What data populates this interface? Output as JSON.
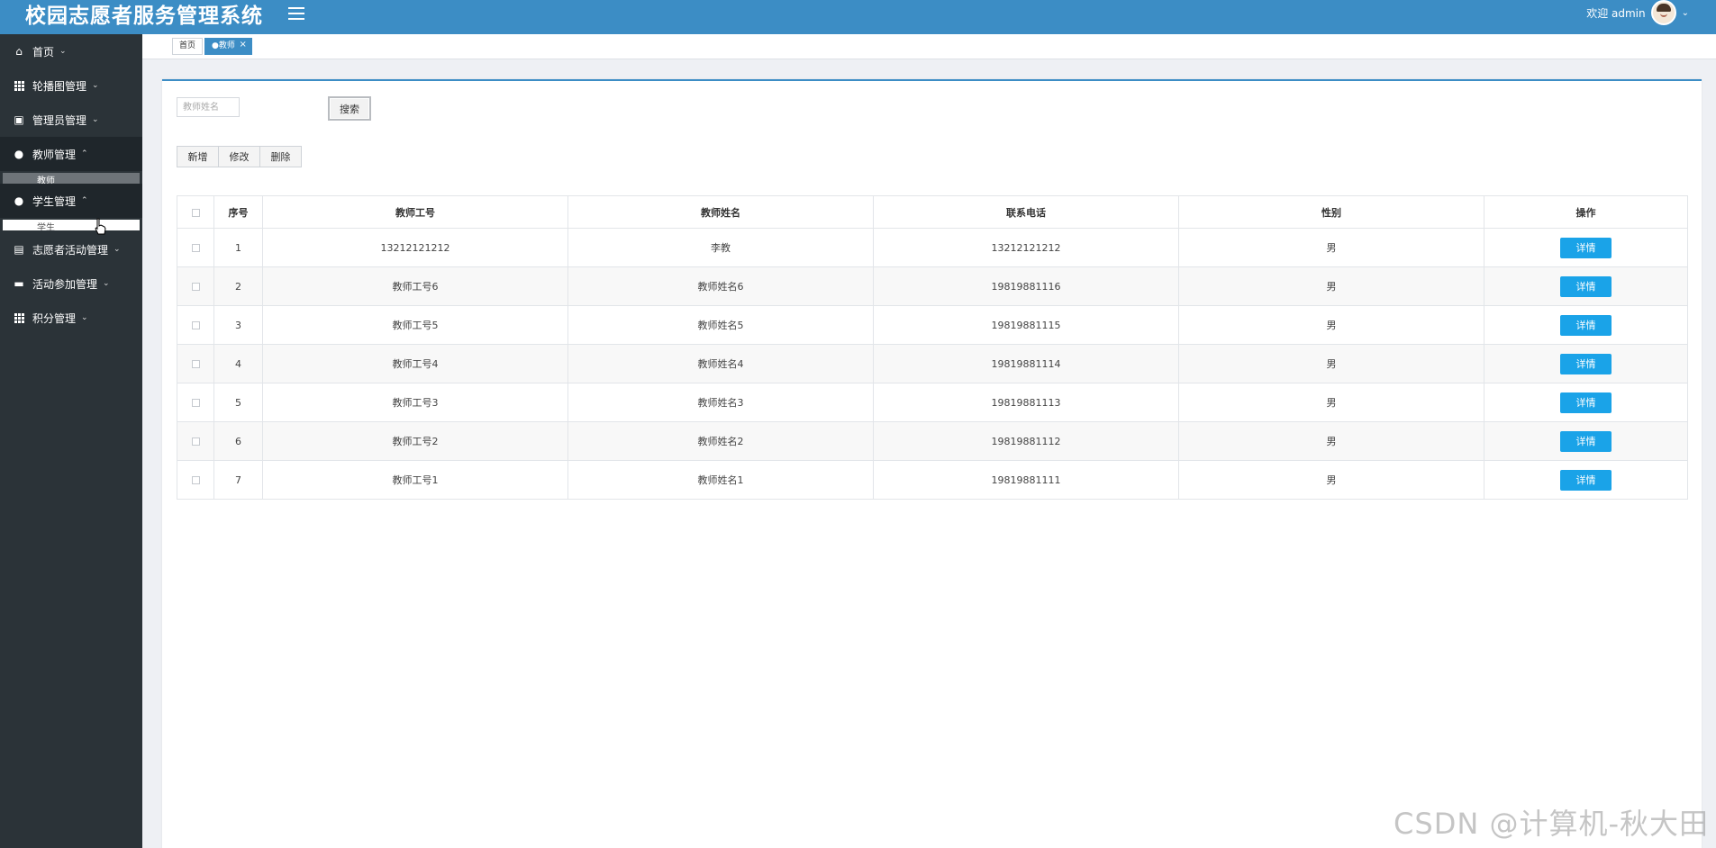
{
  "header": {
    "title": "校园志愿者服务管理系统",
    "welcome": "欢迎 admin"
  },
  "sidebar": {
    "items": [
      {
        "label": "首页",
        "icon": "home-icon"
      },
      {
        "label": "轮播图管理",
        "icon": "grid-icon"
      },
      {
        "label": "管理员管理",
        "icon": "image-icon"
      },
      {
        "label": "教师管理",
        "icon": "user-icon",
        "sub": "教师"
      },
      {
        "label": "学生管理",
        "icon": "user-icon",
        "sub": "学生"
      },
      {
        "label": "志愿者活动管理",
        "icon": "wallet-icon"
      },
      {
        "label": "活动参加管理",
        "icon": "folder-icon"
      },
      {
        "label": "积分管理",
        "icon": "grid-icon"
      }
    ]
  },
  "tabs": {
    "home": "首页",
    "active": "●教师"
  },
  "search": {
    "placeholder": "教师姓名",
    "button": "搜索"
  },
  "actions": {
    "add": "新增",
    "edit": "修改",
    "delete": "删除"
  },
  "table": {
    "columns": [
      "序号",
      "教师工号",
      "教师姓名",
      "联系电话",
      "性别",
      "操作"
    ],
    "detail_label": "详情",
    "rows": [
      {
        "no": "1",
        "id": "13212121212",
        "name": "李教",
        "phone": "13212121212",
        "gender": "男"
      },
      {
        "no": "2",
        "id": "教师工号6",
        "name": "教师姓名6",
        "phone": "19819881116",
        "gender": "男"
      },
      {
        "no": "3",
        "id": "教师工号5",
        "name": "教师姓名5",
        "phone": "19819881115",
        "gender": "男"
      },
      {
        "no": "4",
        "id": "教师工号4",
        "name": "教师姓名4",
        "phone": "19819881114",
        "gender": "男"
      },
      {
        "no": "5",
        "id": "教师工号3",
        "name": "教师姓名3",
        "phone": "19819881113",
        "gender": "男"
      },
      {
        "no": "6",
        "id": "教师工号2",
        "name": "教师姓名2",
        "phone": "19819881112",
        "gender": "男"
      },
      {
        "no": "7",
        "id": "教师工号1",
        "name": "教师姓名1",
        "phone": "19819881111",
        "gender": "男"
      }
    ]
  },
  "watermark": "CSDN @计算机-秋大田",
  "colors": {
    "header": "#3c8dc5",
    "sidebar": "#2b3338",
    "detail_button": "#1aa3e8"
  }
}
